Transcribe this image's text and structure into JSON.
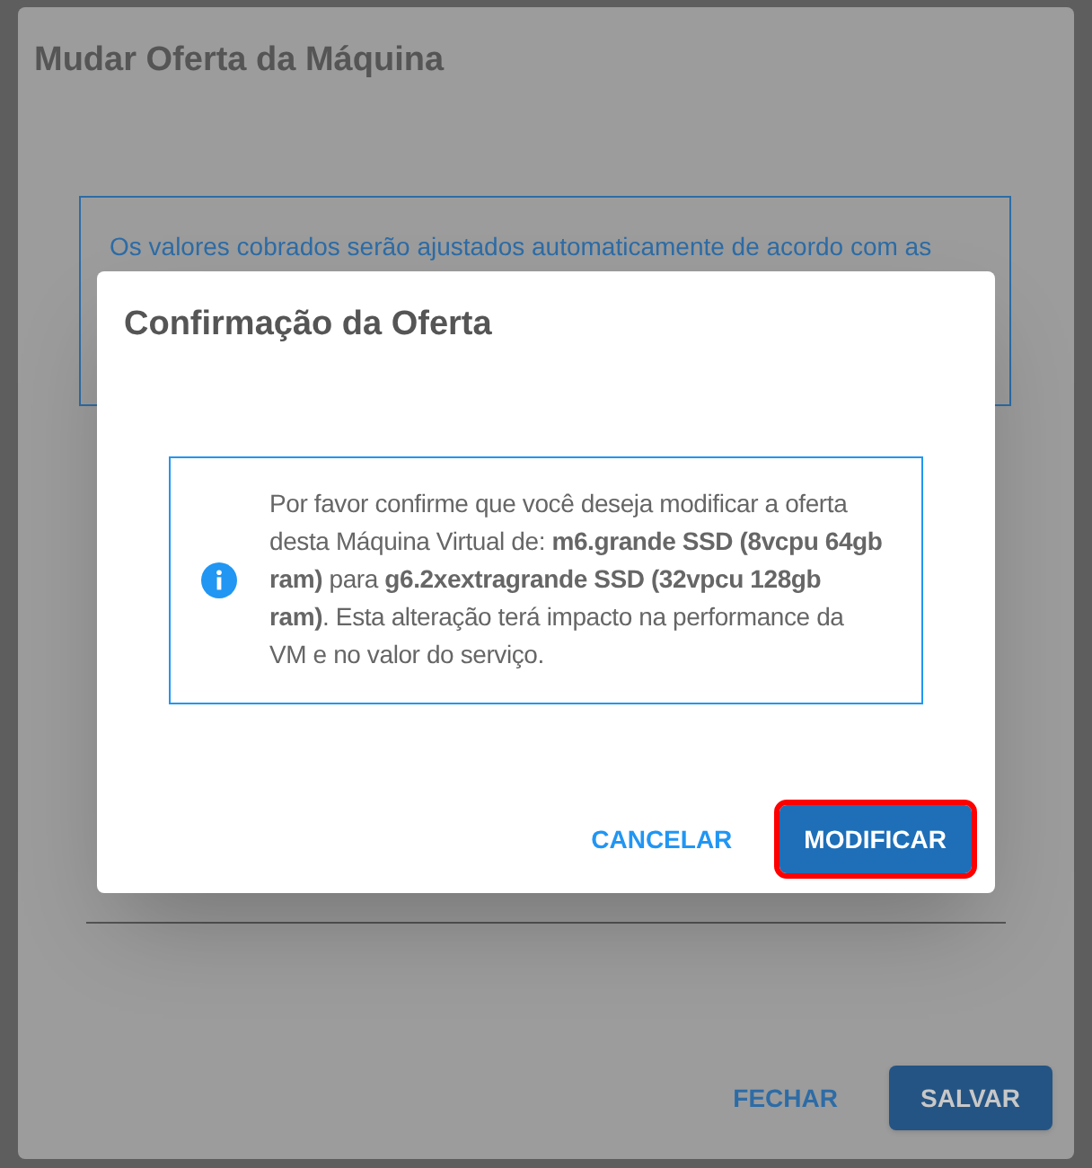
{
  "background_dialog": {
    "title": "Mudar Oferta da Máquina",
    "notice": "Os valores cobrados serão ajustados automaticamente de acordo com as",
    "buttons": [
      {
        "label": "FECHAR",
        "kind": "text"
      },
      {
        "label": "SALVAR",
        "kind": "filled"
      }
    ]
  },
  "confirm_dialog": {
    "title": "Confirmação da Oferta",
    "message": "Por favor confirme que você deseja modificar a oferta desta Máquina Virtual de: **m6.grande SSD (8vcpu 64gb ram)** para **g6.2xextragrande SSD (32vpcu 128gb ram)**. Esta alteração terá impacto na performance da VM e no valor do serviço.",
    "buttons": [
      {
        "label": "CANCELAR",
        "kind": "text",
        "highlighted": false
      },
      {
        "label": "MODIFICAR",
        "kind": "filled",
        "highlighted": true
      }
    ]
  }
}
